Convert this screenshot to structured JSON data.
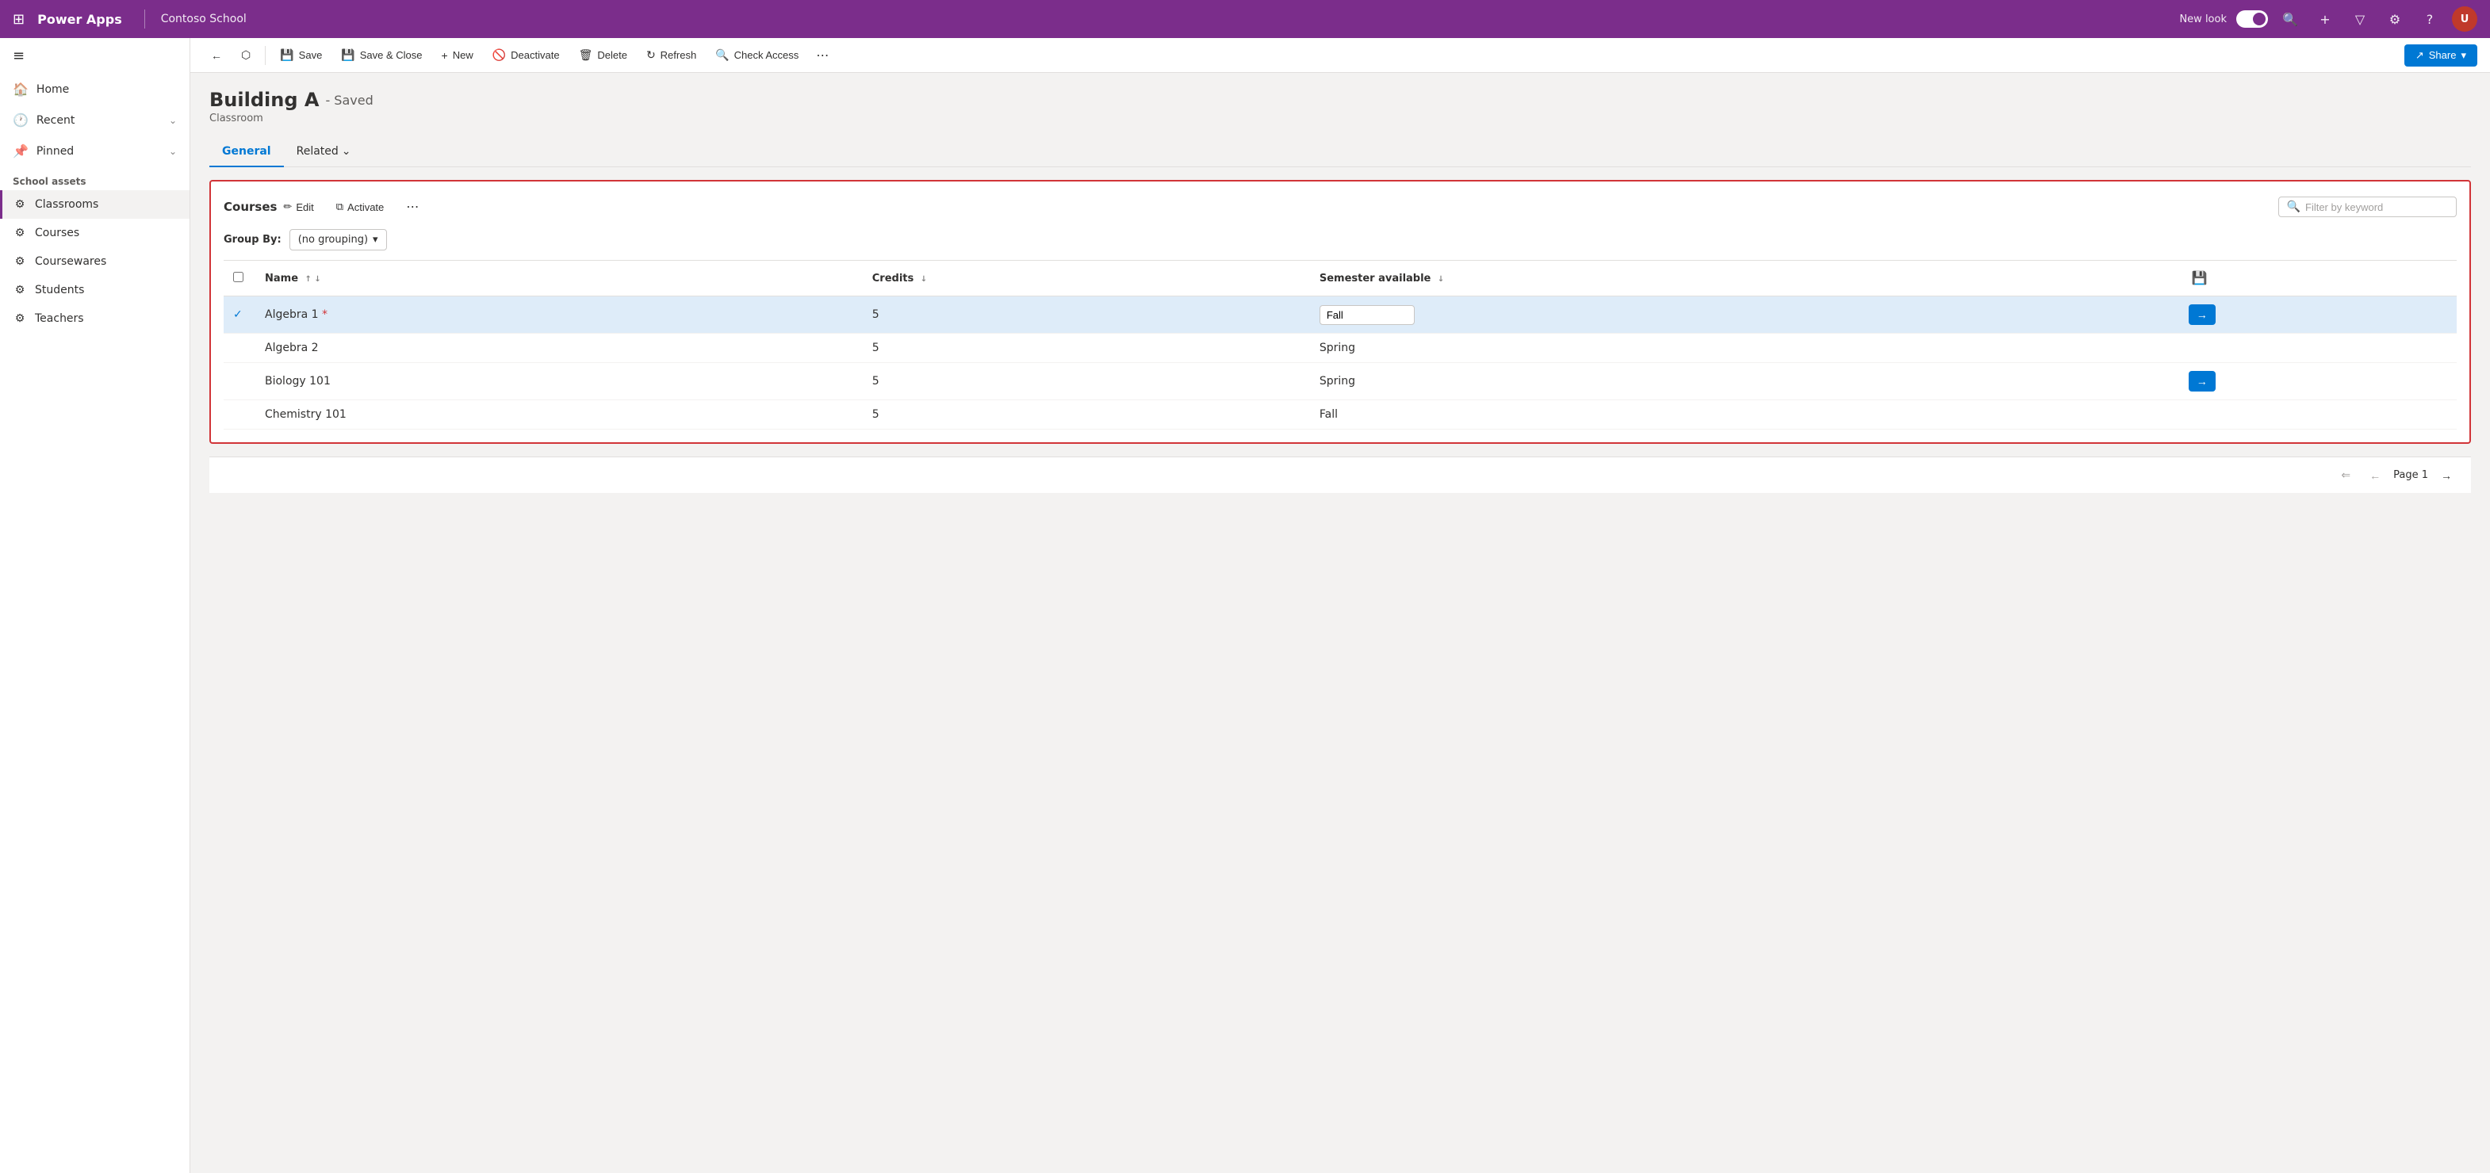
{
  "topNav": {
    "waffle": "⊞",
    "appTitle": "Power Apps",
    "divider": "|",
    "orgName": "Contoso School",
    "newLook": "New look",
    "searchIcon": "🔍",
    "addIcon": "+",
    "filterIcon": "▽",
    "settingsIcon": "⚙",
    "helpIcon": "?",
    "avatarLabel": "U"
  },
  "sidebar": {
    "menuIcon": "≡",
    "navItems": [
      {
        "id": "home",
        "icon": "🏠",
        "label": "Home",
        "hasChevron": false
      },
      {
        "id": "recent",
        "icon": "🕐",
        "label": "Recent",
        "hasChevron": true
      },
      {
        "id": "pinned",
        "icon": "📌",
        "label": "Pinned",
        "hasChevron": true
      }
    ],
    "sectionTitle": "School assets",
    "appItems": [
      {
        "id": "classrooms",
        "icon": "⚙",
        "label": "Classrooms",
        "active": true
      },
      {
        "id": "courses",
        "icon": "⚙",
        "label": "Courses",
        "active": false
      },
      {
        "id": "coursewares",
        "icon": "⚙",
        "label": "Coursewares",
        "active": false
      },
      {
        "id": "students",
        "icon": "⚙",
        "label": "Students",
        "active": false
      },
      {
        "id": "teachers",
        "icon": "⚙",
        "label": "Teachers",
        "active": false
      }
    ]
  },
  "commandBar": {
    "backIcon": "←",
    "openIcon": "⬡",
    "saveIcon": "💾",
    "saveLabel": "Save",
    "saveCloseIcon": "💾",
    "saveCloseLabel": "Save & Close",
    "newIcon": "+",
    "newLabel": "New",
    "deactivateIcon": "🚫",
    "deactivateLabel": "Deactivate",
    "deleteIcon": "🗑",
    "deleteLabel": "Delete",
    "refreshIcon": "↻",
    "refreshLabel": "Refresh",
    "checkAccessIcon": "🔍",
    "checkAccessLabel": "Check Access",
    "moreIcon": "⋯",
    "shareIcon": "↗",
    "shareLabel": "Share",
    "shareChevron": "▾"
  },
  "record": {
    "title": "Building A",
    "savedBadge": "- Saved",
    "subtitle": "Classroom"
  },
  "tabs": [
    {
      "id": "general",
      "label": "General",
      "active": true
    },
    {
      "id": "related",
      "label": "Related",
      "active": false,
      "hasChevron": true
    }
  ],
  "courses": {
    "sectionTitle": "Courses",
    "editIcon": "✏",
    "editLabel": "Edit",
    "copyIcon": "⧉",
    "activateLabel": "Activate",
    "moreIcon": "⋯",
    "filterPlaceholder": "Filter by keyword",
    "filterIcon": "🔍",
    "groupByLabel": "Group By:",
    "groupByValue": "(no grouping)",
    "groupByChevron": "▾",
    "saveTableIcon": "💾",
    "columns": [
      {
        "id": "name",
        "label": "Name",
        "sortAsc": true,
        "hasBothSort": true
      },
      {
        "id": "credits",
        "label": "Credits",
        "hasDownSort": true
      },
      {
        "id": "semester",
        "label": "Semester available",
        "hasDownSort": true
      }
    ],
    "rows": [
      {
        "id": "algebra1",
        "selected": true,
        "name": "Algebra 1",
        "hasAsterisk": true,
        "credits": 5,
        "semester": "Fall",
        "hasSemesterInput": true,
        "hasArrow": true
      },
      {
        "id": "algebra2",
        "selected": false,
        "name": "Algebra 2",
        "hasAsterisk": false,
        "credits": 5,
        "semester": "Spring",
        "hasArrow": false
      },
      {
        "id": "biology101",
        "selected": false,
        "name": "Biology 101",
        "hasAsterisk": false,
        "credits": 5,
        "semester": "Spring",
        "hasArrow": true
      },
      {
        "id": "chemistry101",
        "selected": false,
        "name": "Chemistry 101",
        "hasAsterisk": false,
        "credits": 5,
        "semester": "Fall",
        "hasArrow": false
      }
    ]
  },
  "pagination": {
    "firstIcon": "⇐",
    "prevIcon": "←",
    "pageLabel": "Page 1",
    "nextIcon": "→",
    "firstDisabled": true,
    "prevDisabled": true
  }
}
